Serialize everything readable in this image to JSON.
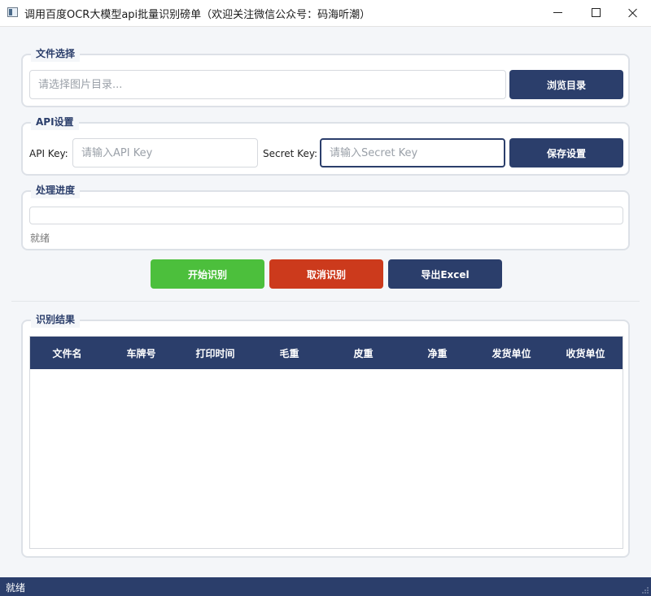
{
  "window": {
    "title": "调用百度OCR大模型api批量识别磅单（欢迎关注微信公众号：码海听潮）",
    "icon": "app-window-icon"
  },
  "file_section": {
    "title": "文件选择",
    "directory_placeholder": "请选择图片目录...",
    "browse_label": "浏览目录"
  },
  "api_section": {
    "title": "API设置",
    "api_key_label": "API Key:",
    "api_key_placeholder": "请输入API Key",
    "secret_key_label": "Secret Key:",
    "secret_key_placeholder": "请输入Secret Key",
    "save_label": "保存设置"
  },
  "progress_section": {
    "title": "处理进度",
    "progress_value": 0,
    "status_text": "就绪"
  },
  "actions": {
    "start_label": "开始识别",
    "cancel_label": "取消识别",
    "export_label": "导出Excel"
  },
  "results_section": {
    "title": "识别结果",
    "columns": [
      "文件名",
      "车牌号",
      "打印时间",
      "毛重",
      "皮重",
      "净重",
      "发货单位",
      "收货单位"
    ],
    "rows": []
  },
  "statusbar": {
    "text": "就绪"
  },
  "colors": {
    "primary": "#2b3e6b",
    "start": "#4cbf3c",
    "cancel": "#cc3a1c",
    "background": "#f4f6f9"
  }
}
